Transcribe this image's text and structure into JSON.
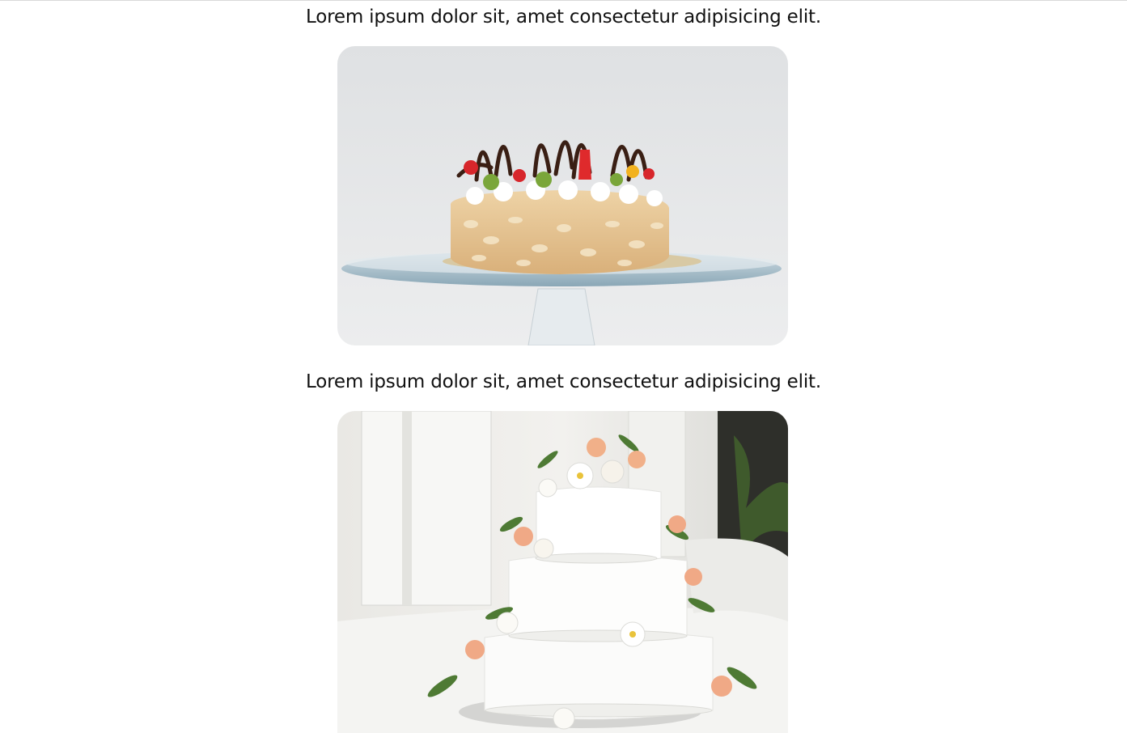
{
  "posts": [
    {
      "caption": "Lorem ipsum dolor sit, amet consectetur adipisicing elit."
    },
    {
      "caption": "Lorem ipsum dolor sit, amet consectetur adipisicing elit."
    }
  ],
  "colors": {
    "background": "#ffffff",
    "text": "#111111",
    "divider": "#d9d9d9"
  }
}
